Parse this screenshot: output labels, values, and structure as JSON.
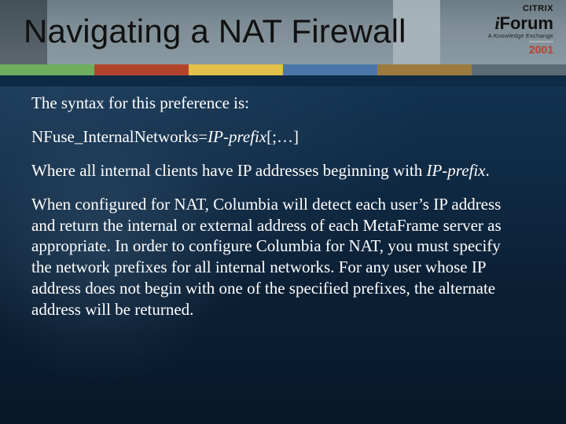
{
  "header": {
    "title": "Navigating a NAT Firewall",
    "logo": {
      "brand_small": "CITRIX",
      "iforum_i": "i",
      "iforum_rest": "Forum",
      "subtitle": "A Knowledge Exchange",
      "year": "2001"
    }
  },
  "body": {
    "p1": "The syntax for this preference is:",
    "syntax_prefix": "NFuse_InternalNetworks=",
    "syntax_italic": "IP-prefix",
    "syntax_suffix": "[;…]",
    "p3_a": "Where all internal clients have IP addresses beginning with ",
    "p3_italic": "IP-prefix",
    "p3_b": ".",
    "p4": "When configured for NAT, Columbia will detect each user’s IP address and return the internal or external address of each MetaFrame server as appropriate.  In order to configure Columbia for NAT, you must specify the network prefixes for all internal networks.  For any user whose IP address does not begin with one of the specified prefixes, the alternate address will be returned."
  }
}
